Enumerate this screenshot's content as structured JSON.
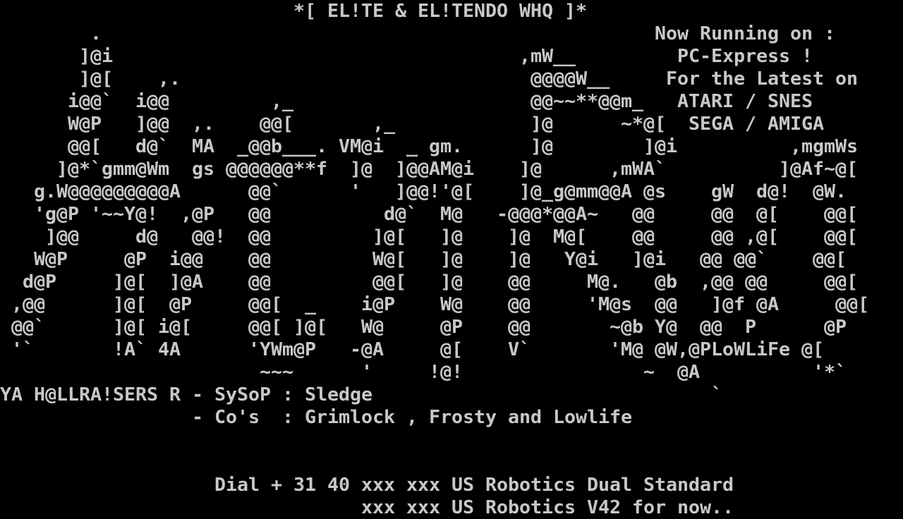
{
  "colors": {
    "background": "#000000",
    "text": "#c8c8c8"
  },
  "screen": {
    "lines": [
      "                          *[ EL!TE & EL!TENDO WHQ ]*",
      "        .                                                 Now Running on :",
      "       ]@i                                    ,mW__         PC-Express !",
      "       ]@[    ,.                               @@@@W__     For the Latest on",
      "      i@@`  i@@         ,_                     @@~~**@@m_   ATARI / SNES",
      "      W@P   ]@@  ,.    @@[       ,_            ]@      ~*@[  SEGA / AMIGA",
      "      @@[   d@`  MA  _@@b___. VM@i  _ gm.      ]@        ]@i          ,mgmWs",
      "     ]@*`gmm@Wm  gs @@@@@@**f  ]@  ]@@AM@i    ]@      ,mWA`          ]@Af~@[",
      "   g.W@@@@@@@@@A      @@`      '   ]@@!'@[    ]@_g@mm@@A @s    gW  d@!  @W.",
      "   'g@P '~~Y@!  ,@P   @@          d@`  M@   -@@@*@@A~   @@     @@  @[    @@[",
      "    ]@@     d@   @@!  @@         ]@[   ]@    ]@  M@[    @@     @@ ,@[    @@[",
      "   W@P     @P  i@@    @@         W@[   ]@    ]@   Y@i   ]@i   @@ @@`    @@[",
      "  d@P     ]@[  ]@A    @@         @@[   ]@    @@     M@.   @b  ,@@ @@     @@[",
      " ,@@      ]@[  @P     @@[  _    i@P    W@    @@     'M@s  @@   ]@f @A     @@[",
      " @@`      ]@[ i@[     @@[ ]@[   W@     @P    @@       ~@b Y@  @@  P      @P",
      " '`       !A` 4A      'YWm@P   -@A     @[    V`       'M@ @W,@PLoWLiFe @[",
      "                       ~~~      '     !@!                ~  @A          '*`",
      "YA H@LLRA!SERS R - SySoP : Sledge                              `",
      "                 - Co's  : Grimlock , Frosty and Lowlife",
      "",
      "",
      "                   Dial + 31 40 xxx xxx US Robotics Dual Standard",
      "                                xxx xxx US Robotics V42 for now.."
    ]
  }
}
